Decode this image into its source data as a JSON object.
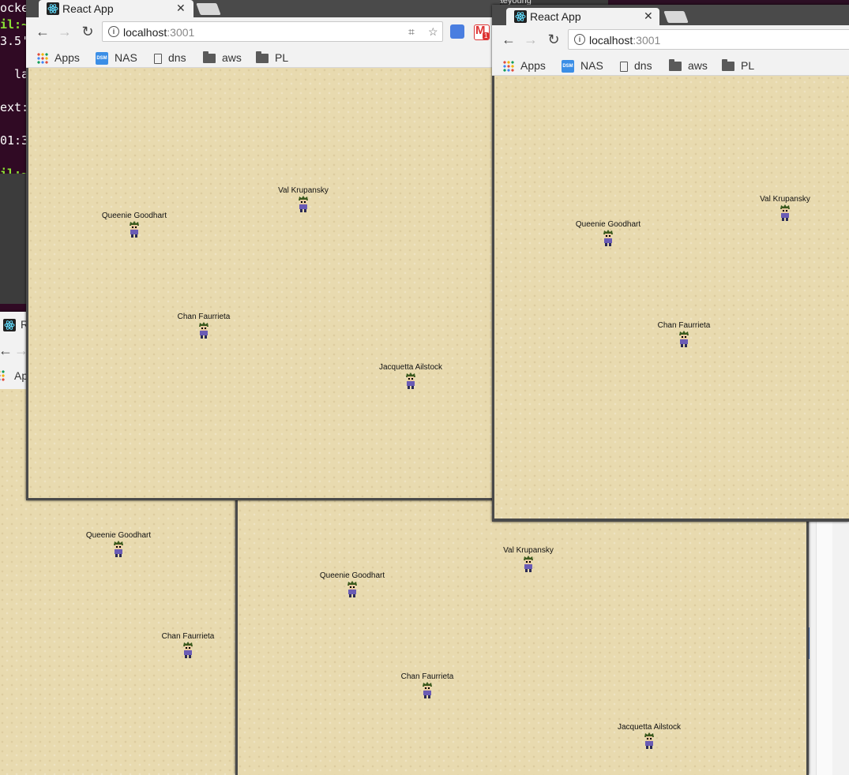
{
  "terminal": {
    "lines": [
      "ocke",
      "il:~",
      "3.5'",
      "",
      "  lac",
      "",
      "ext:",
      "",
      "01:3",
      "",
      "il:~"
    ]
  },
  "browser": {
    "tab_title": "React App",
    "url_host": "localhost",
    "url_port": ":3001",
    "bookmarks": {
      "apps": "Apps",
      "nas": "NAS",
      "dns": "dns",
      "aws": "aws",
      "pl": "PL"
    },
    "gmail_badge": "1",
    "partial_tab_title": "R",
    "partial_bookmark": "Ap",
    "background_window_title": "raeyoung"
  },
  "players": {
    "queenie": "Queenie Goodhart",
    "val": "Val Krupansky",
    "chan": "Chan Faurrieta",
    "jacquetta": "Jacquetta Ailstock"
  },
  "colors": {
    "ground": "#e8daaf",
    "chrome_bg": "#f2f2f2",
    "window_frame": "#4a4a4a",
    "terminal_bg": "#300a24",
    "terminal_prompt": "#8ae234"
  }
}
